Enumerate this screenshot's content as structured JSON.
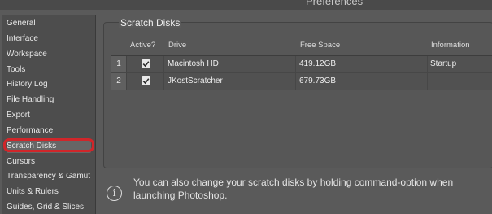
{
  "window": {
    "title": "Preferences"
  },
  "sidebar": {
    "items": [
      {
        "label": "General"
      },
      {
        "label": "Interface"
      },
      {
        "label": "Workspace"
      },
      {
        "label": "Tools"
      },
      {
        "label": "History Log"
      },
      {
        "label": "File Handling"
      },
      {
        "label": "Export"
      },
      {
        "label": "Performance"
      },
      {
        "label": "Scratch Disks",
        "selected": true
      },
      {
        "label": "Cursors"
      },
      {
        "label": "Transparency & Gamut"
      },
      {
        "label": "Units & Rulers"
      },
      {
        "label": "Guides, Grid & Slices"
      }
    ],
    "highlight_color": "#d0262a"
  },
  "scratch_disks": {
    "group_title": "Scratch Disks",
    "columns": {
      "active": "Active?",
      "drive": "Drive",
      "free_space": "Free Space",
      "information": "Information"
    },
    "rows": [
      {
        "index": "1",
        "active": true,
        "drive": "Macintosh HD",
        "free_space": "419.12GB",
        "information": "Startup"
      },
      {
        "index": "2",
        "active": true,
        "drive": "JKostScratcher",
        "free_space": "679.73GB",
        "information": ""
      }
    ]
  },
  "info": {
    "icon": "info-icon",
    "message": "You can also change your scratch disks by holding command-option when launching Photoshop."
  }
}
